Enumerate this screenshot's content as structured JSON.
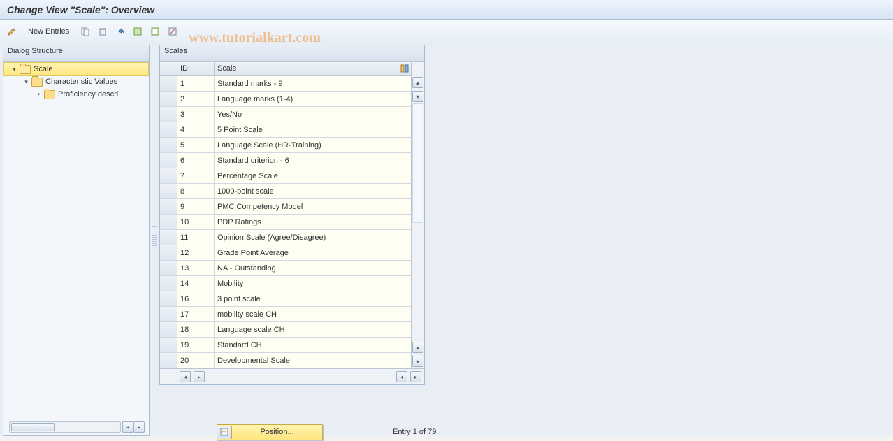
{
  "title": "Change View \"Scale\": Overview",
  "watermark": "www.tutorialkart.com",
  "toolbar": {
    "new_entries_label": "New Entries"
  },
  "dialog": {
    "header": "Dialog Structure",
    "tree": {
      "scale": "Scale",
      "characteristic_values": "Characteristic Values",
      "proficiency": "Proficiency descri"
    }
  },
  "scales": {
    "header": "Scales",
    "col_id": "ID",
    "col_scale": "Scale",
    "rows": [
      {
        "id": "1",
        "scale": "Standard marks - 9"
      },
      {
        "id": "2",
        "scale": "Language marks (1-4)"
      },
      {
        "id": "3",
        "scale": "Yes/No"
      },
      {
        "id": "4",
        "scale": "5 Point Scale"
      },
      {
        "id": "5",
        "scale": "Language Scale (HR-Training)"
      },
      {
        "id": "6",
        "scale": "Standard criterion - 6"
      },
      {
        "id": "7",
        "scale": "Percentage Scale"
      },
      {
        "id": "8",
        "scale": "1000-point scale"
      },
      {
        "id": "9",
        "scale": "PMC Competency Model"
      },
      {
        "id": "10",
        "scale": "PDP Ratings"
      },
      {
        "id": "11",
        "scale": "Opinion Scale (Agree/Disagree)"
      },
      {
        "id": "12",
        "scale": "Grade Point Average"
      },
      {
        "id": "13",
        "scale": "NA - Outstanding"
      },
      {
        "id": "14",
        "scale": "Mobility"
      },
      {
        "id": "16",
        "scale": "3 point scale"
      },
      {
        "id": "17",
        "scale": "mobility scale CH"
      },
      {
        "id": "18",
        "scale": "Language scale CH"
      },
      {
        "id": "19",
        "scale": "Standard CH"
      },
      {
        "id": "20",
        "scale": "Developmental Scale"
      }
    ]
  },
  "footer": {
    "position_label": "Position...",
    "entry_text": "Entry 1 of 79"
  }
}
